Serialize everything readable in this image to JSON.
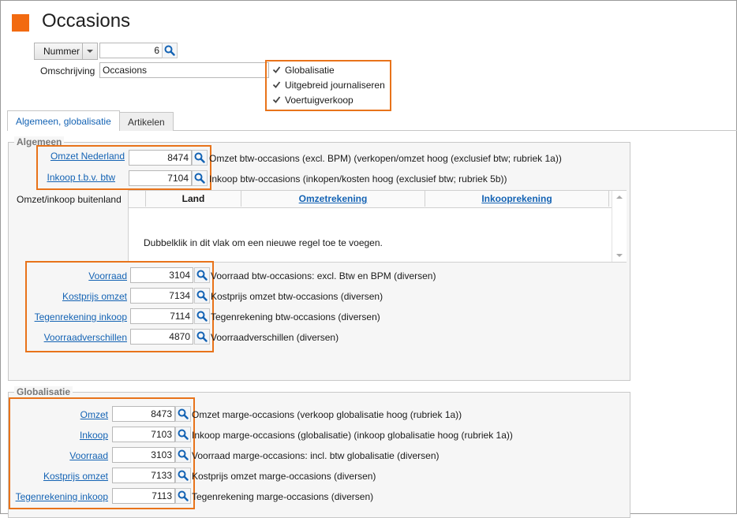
{
  "title": "Occasions",
  "header": {
    "nummer_label": "Nummer",
    "nummer_value": "6",
    "omschrijving_label": "Omschrijving",
    "omschrijving_value": "Occasions"
  },
  "checkboxes": [
    {
      "label": "Globalisatie",
      "checked": true
    },
    {
      "label": "Uitgebreid journaliseren",
      "checked": true
    },
    {
      "label": "Voertuigverkoop",
      "checked": true
    }
  ],
  "tabs": [
    {
      "label": "Algemeen, globalisatie",
      "active": true
    },
    {
      "label": "Artikelen",
      "active": false
    }
  ],
  "algemeen": {
    "title": "Algemeen",
    "rows_top": [
      {
        "label": "Omzet Nederland",
        "value": "8474",
        "desc": "Omzet btw-occasions (excl. BPM) (verkopen/omzet hoog (exclusief btw; rubriek 1a))"
      },
      {
        "label": "Inkoop t.b.v. btw",
        "value": "7104",
        "desc": "Inkoop btw-occasions (inkopen/kosten hoog (exclusief btw; rubriek 5b))"
      }
    ],
    "buitenland_label": "Omzet/inkoop buitenland",
    "grid_headers": [
      "Land",
      "Omzetrekening",
      "Inkooprekening"
    ],
    "grid_placeholder": "Dubbelklik in dit vlak om een nieuwe regel toe te voegen.",
    "rows_bottom": [
      {
        "label": "Voorraad",
        "value": "3104",
        "desc": "Voorraad btw-occasions: excl. Btw en BPM (diversen)"
      },
      {
        "label": "Kostprijs omzet",
        "value": "7134",
        "desc": "Kostprijs omzet btw-occasions (diversen)"
      },
      {
        "label": "Tegenrekening inkoop",
        "value": "7114",
        "desc": "Tegenrekening btw-occasions (diversen)"
      },
      {
        "label": "Voorraadverschillen",
        "value": "4870",
        "desc": "Voorraadverschillen (diversen)"
      }
    ]
  },
  "globalisatie": {
    "title": "Globalisatie",
    "rows": [
      {
        "label": "Omzet",
        "value": "8473",
        "desc": "Omzet marge-occasions (verkoop globalisatie hoog (rubriek 1a))"
      },
      {
        "label": "Inkoop",
        "value": "7103",
        "desc": "Inkoop marge-occasions (globalisatie) (inkoop globalisatie hoog (rubriek 1a))"
      },
      {
        "label": "Voorraad",
        "value": "3103",
        "desc": "Voorraad marge-occasions: incl. btw globalisatie (diversen)"
      },
      {
        "label": "Kostprijs omzet",
        "value": "7133",
        "desc": "Kostprijs omzet marge-occasions (diversen)"
      },
      {
        "label": "Tegenrekening inkoop",
        "value": "7113",
        "desc": "Tegenrekening marge-occasions (diversen)"
      }
    ]
  },
  "colors": {
    "accent": "#f26a10",
    "highlight": "#e8731a",
    "link": "#1463b4"
  }
}
